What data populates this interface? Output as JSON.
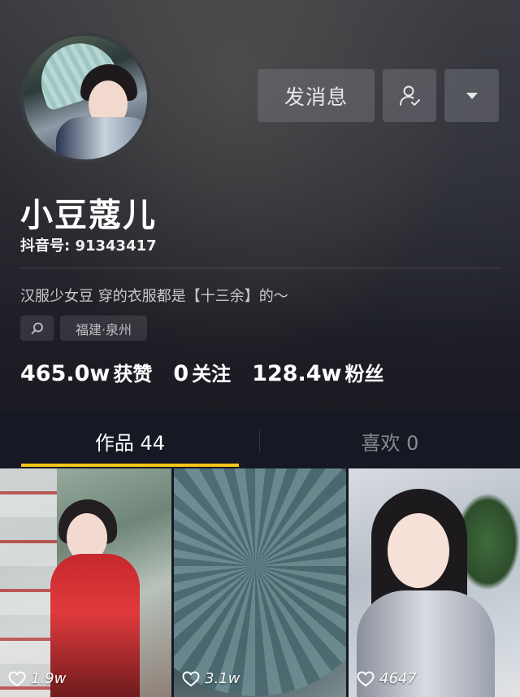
{
  "profile": {
    "name": "小豆蔻儿",
    "uid": "抖音号: 91343417",
    "bio": "汉服少女豆 穿的衣服都是【十三余】的～",
    "location": "福建·泉州",
    "search_icon": "search-icon",
    "follow_icon": "user-check-icon",
    "more_icon": "caret-down-icon"
  },
  "actions": {
    "message_label": "发消息"
  },
  "stats": {
    "likes_value": "465.0w",
    "likes_label": "获赞",
    "following_value": "0",
    "following_label": "关注",
    "fans_value": "128.4w",
    "fans_label": "粉丝"
  },
  "tabs": {
    "works_label": "作品 44",
    "likes_label": "喜欢 0",
    "active": "works",
    "accent_color": "#f5c518"
  },
  "videos": [
    {
      "likes": "1.9w"
    },
    {
      "likes": "3.1w"
    },
    {
      "likes": "4647"
    }
  ],
  "colors": {
    "background": "#161823",
    "button_bg": "#6e7076"
  }
}
